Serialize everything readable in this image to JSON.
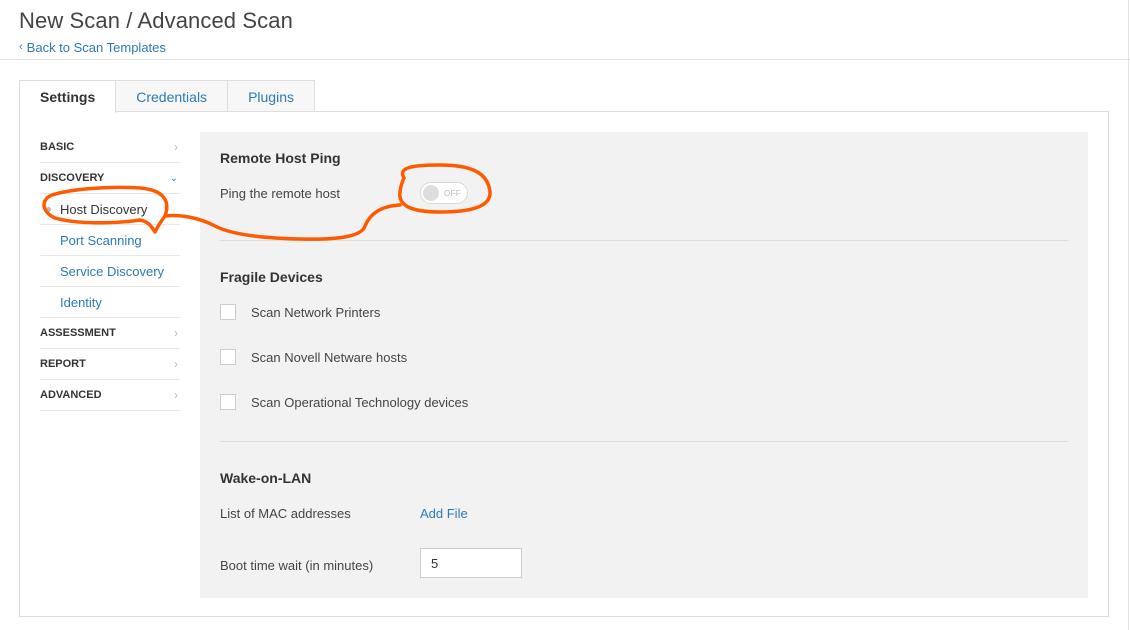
{
  "header": {
    "title": "New Scan / Advanced Scan",
    "back_chevron": "‹",
    "back_label": "Back to Scan Templates"
  },
  "tabs": [
    {
      "label": "Settings",
      "active": true
    },
    {
      "label": "Credentials",
      "active": false
    },
    {
      "label": "Plugins",
      "active": false
    }
  ],
  "sidebar": {
    "sections": [
      {
        "label": "BASIC",
        "icon": "chevron-right-icon"
      },
      {
        "label": "DISCOVERY",
        "icon": "chevron-down-icon",
        "expanded": true,
        "items": [
          {
            "label": "Host Discovery",
            "active": true
          },
          {
            "label": "Port Scanning"
          },
          {
            "label": "Service Discovery"
          },
          {
            "label": "Identity"
          }
        ]
      },
      {
        "label": "ASSESSMENT",
        "icon": "chevron-right-icon"
      },
      {
        "label": "REPORT",
        "icon": "chevron-right-icon"
      },
      {
        "label": "ADVANCED",
        "icon": "chevron-right-icon"
      }
    ]
  },
  "main": {
    "remote_host_ping": {
      "title": "Remote Host Ping",
      "ping_label": "Ping the remote host",
      "toggle_state": "OFF"
    },
    "fragile_devices": {
      "title": "Fragile Devices",
      "options": [
        {
          "label": "Scan Network Printers",
          "checked": false
        },
        {
          "label": "Scan Novell Netware hosts",
          "checked": false
        },
        {
          "label": "Scan Operational Technology devices",
          "checked": false
        }
      ]
    },
    "wake_on_lan": {
      "title": "Wake-on-LAN",
      "mac_label": "List of MAC addresses",
      "add_file": "Add File",
      "boot_label": "Boot time wait (in minutes)",
      "boot_value": "5"
    }
  },
  "colors": {
    "link": "#2b7bb9",
    "content_bg": "#f2f2f2",
    "annotation": "#ff5a00"
  }
}
